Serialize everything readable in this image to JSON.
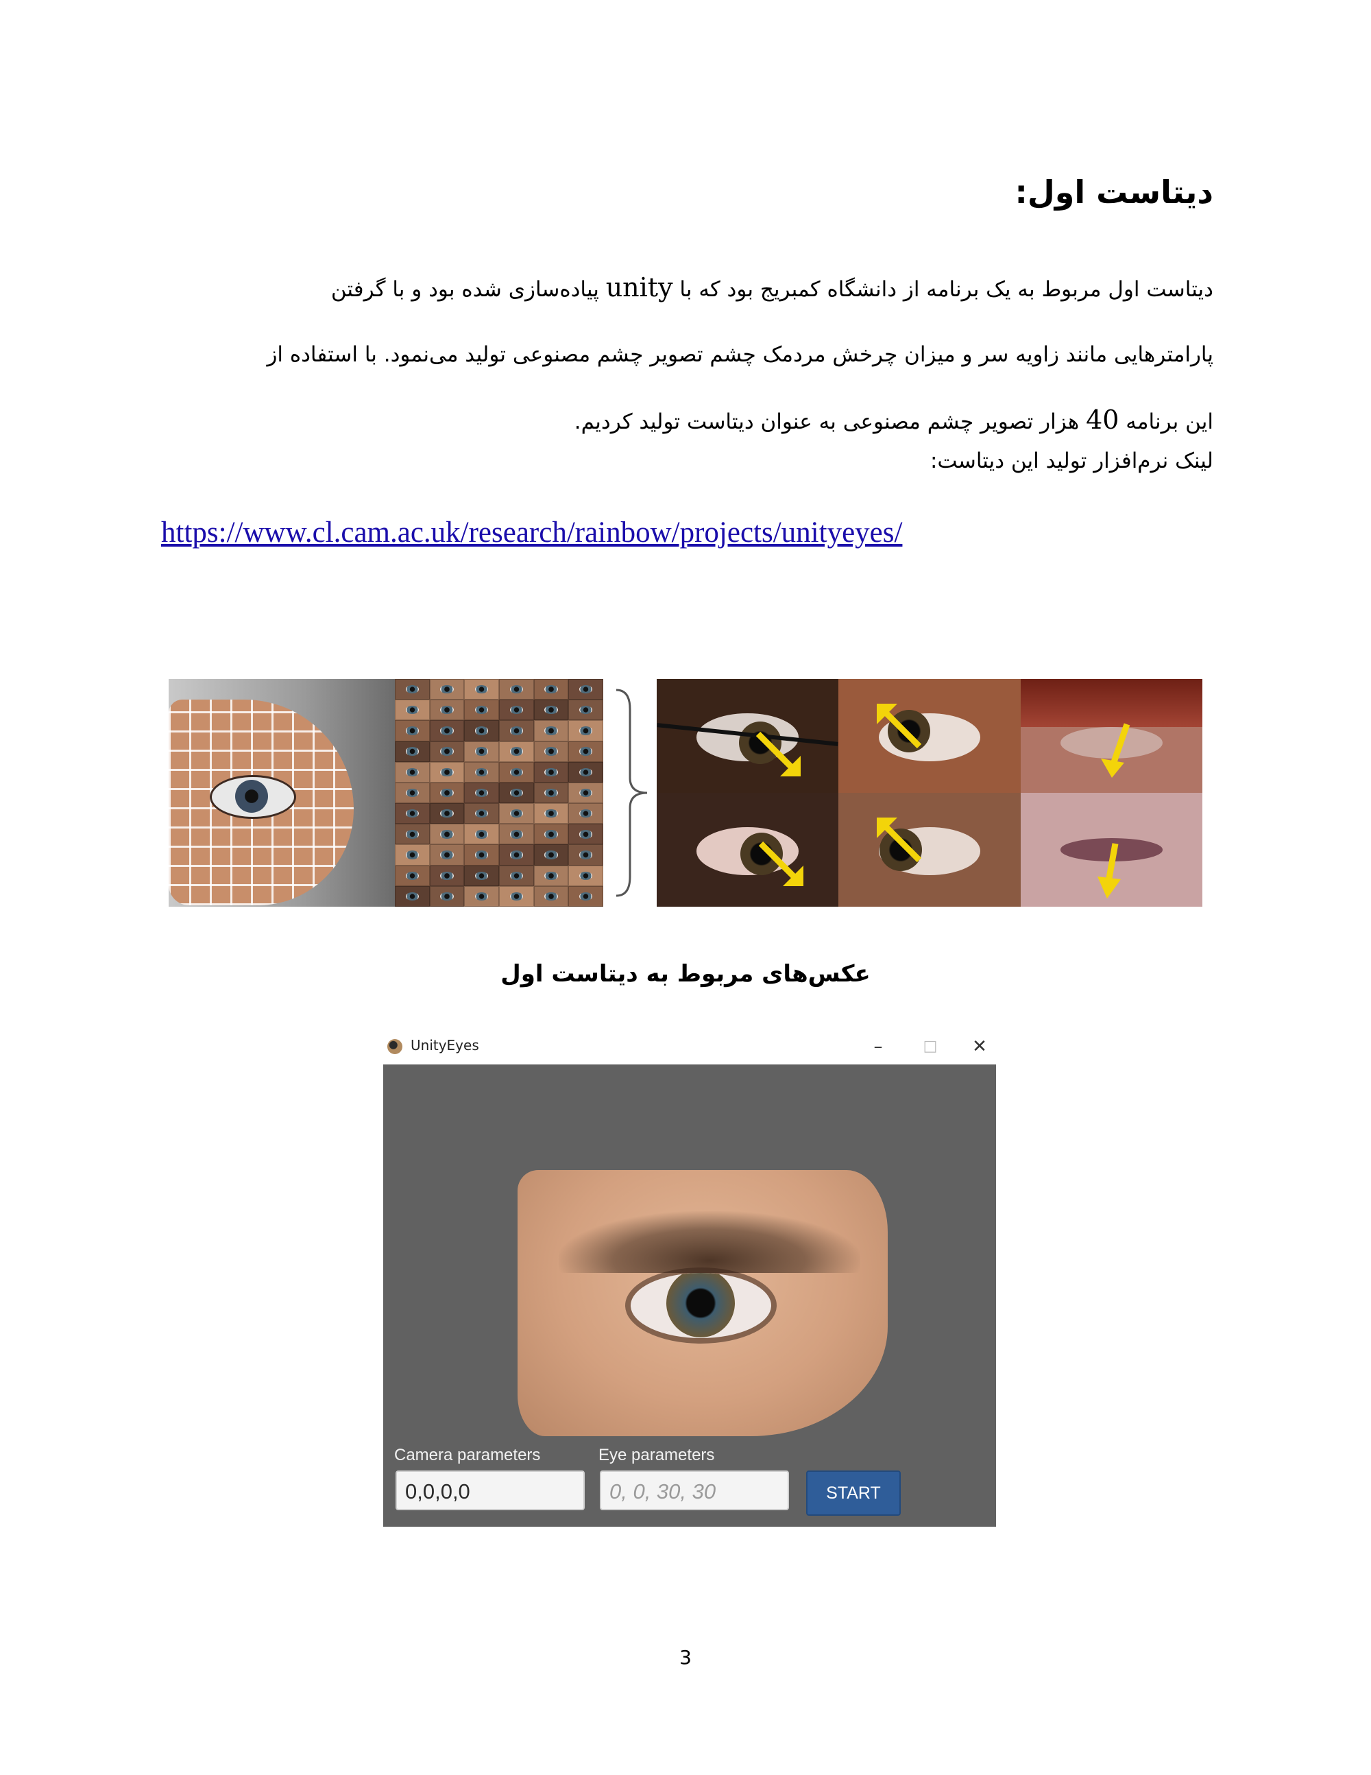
{
  "heading": "دیتاست اول:",
  "paragraph": {
    "line1_pre": "دیتاست اول مربوط به یک برنامه از دانشگاه کمبریج  بود  که با ",
    "line1_latin": "unity",
    "line1_post": " پیاده‌سازی شده بود و با گرفتن",
    "line2": "پارامترهایی مانند زاویه سر و میزان چرخش مردمک چشم تصویر چشم مصنوعی تولید می‌نمود. با استفاده از",
    "line3_pre": "این برنامه ",
    "line3_num": "40",
    "line3_post": " هزار تصویر چشم مصنوعی به عنوان دیتاست تولید کردیم."
  },
  "link_label": "لینک نرم‌افزار تولید این دیتاست:",
  "link_url": "https://www.cl.cam.ac.uk/research/rainbow/projects/unityeyes/",
  "figure_caption": "عکس‌های مربوط به دیتاست اول",
  "unity_window": {
    "title": "UnityEyes",
    "minimize": "–",
    "maximize": "□",
    "close": "✕",
    "camera_label": "Camera parameters",
    "camera_value": "0,0,0,0",
    "eye_label": "Eye parameters",
    "eye_placeholder": "0, 0, 30, 30",
    "start_label": "START"
  },
  "page_number": "3",
  "colors": {
    "link": "#1a0dab",
    "start_button": "#2f5d99",
    "viewport_bg": "#616161"
  },
  "icons": {
    "gaze_arrow": "yellow-arrow-icon",
    "app_icon": "unityeyes-app-icon"
  }
}
